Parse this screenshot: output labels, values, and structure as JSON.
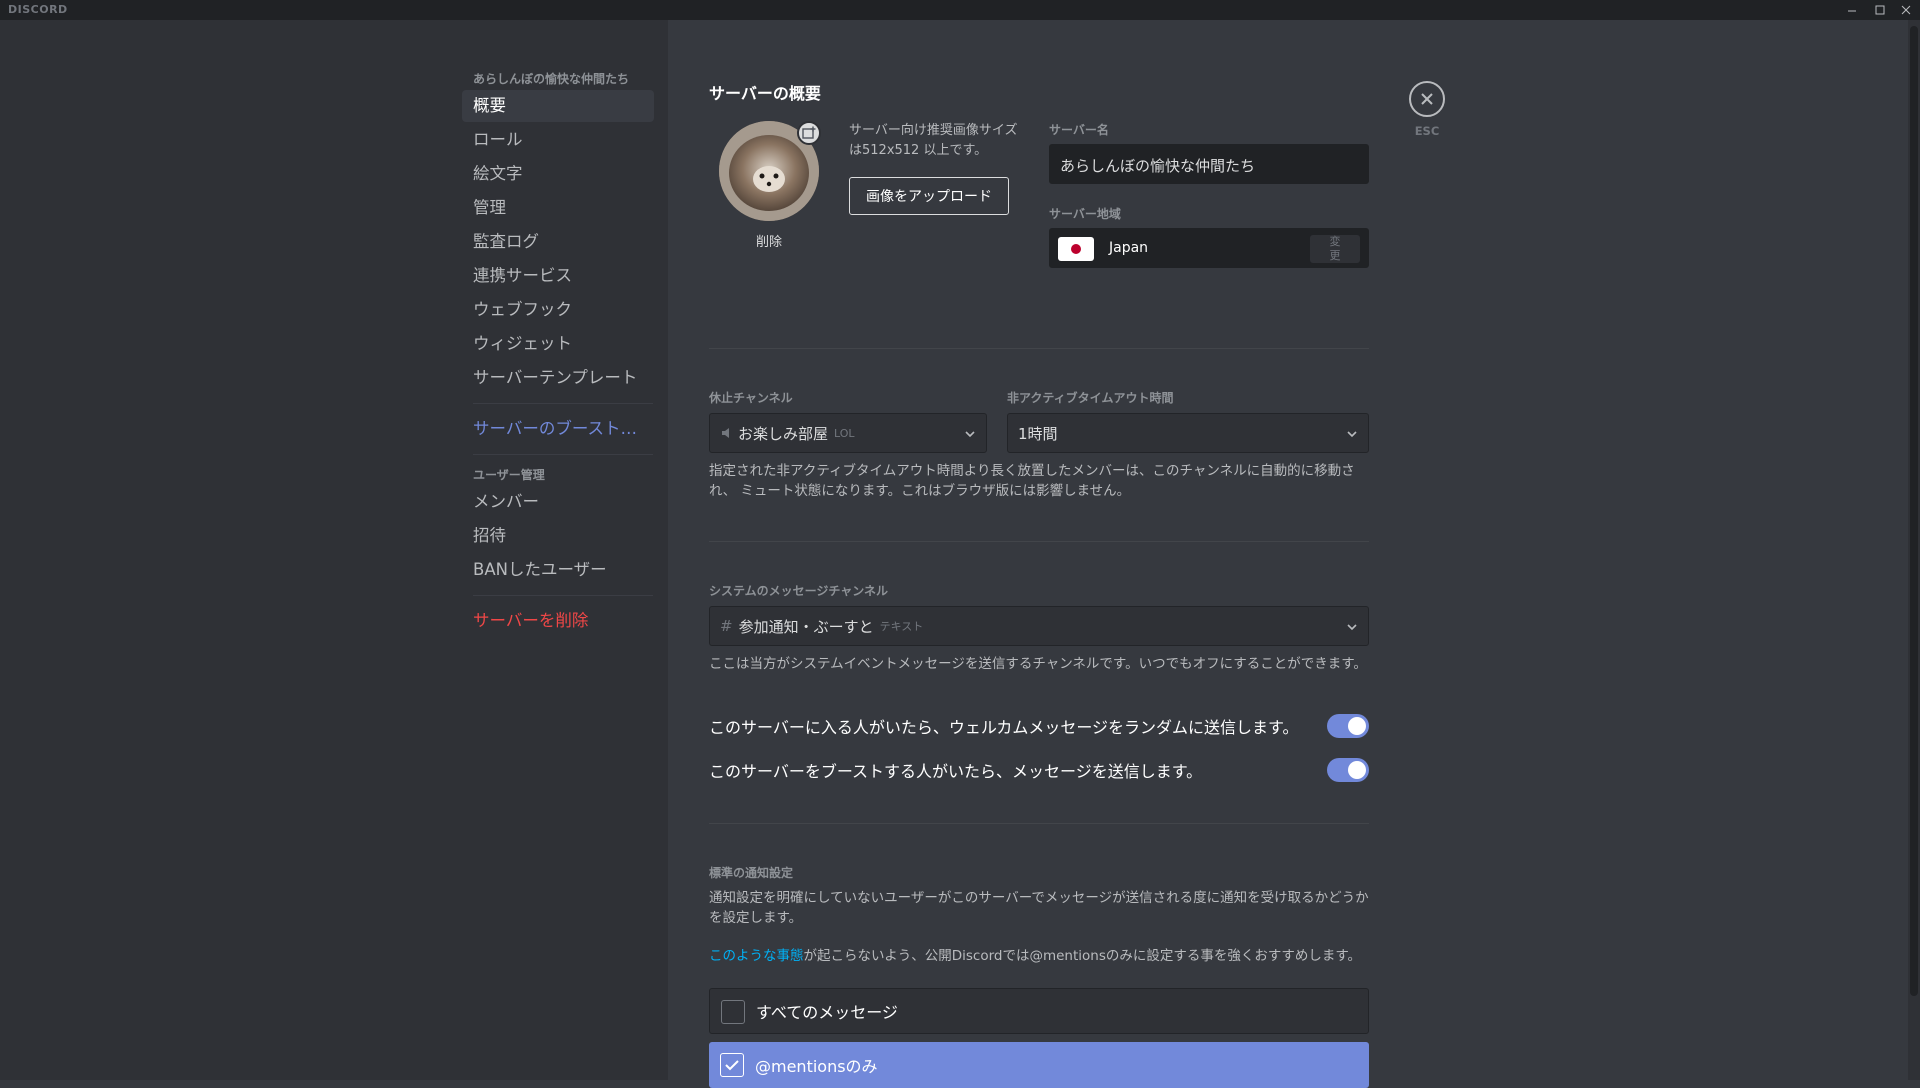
{
  "app": {
    "brand": "DISCORD"
  },
  "sidebar": {
    "server_header": "あらしんぼの愉快な仲間たち",
    "items": [
      {
        "label": "概要"
      },
      {
        "label": "ロール"
      },
      {
        "label": "絵文字"
      },
      {
        "label": "管理"
      },
      {
        "label": "監査ログ"
      },
      {
        "label": "連携サービス"
      },
      {
        "label": "ウェブフック"
      },
      {
        "label": "ウィジェット"
      },
      {
        "label": "サーバーテンプレート"
      }
    ],
    "boost_label": "サーバーのブースト状...",
    "user_header": "ユーザー管理",
    "user_items": [
      {
        "label": "メンバー"
      },
      {
        "label": "招待"
      },
      {
        "label": "BANしたユーザー"
      }
    ],
    "delete_label": "サーバーを削除"
  },
  "overview": {
    "title": "サーバーの概要",
    "image_hint": "サーバー向け推奨画像サイズは512x512 以上です。",
    "upload_button": "画像をアップロード",
    "remove_label": "削除",
    "server_name_label": "サーバー名",
    "server_name_value": "あらしんぼの愉快な仲間たち",
    "region_label": "サーバー地域",
    "region_value": "Japan",
    "region_change": "変更"
  },
  "afk": {
    "channel_label": "休止チャンネル",
    "channel_value": "お楽しみ部屋",
    "channel_tag": "LOL",
    "timeout_label": "非アクティブタイムアウト時間",
    "timeout_value": "1時間",
    "description": "指定された非アクティブタイムアウト時間より長く放置したメンバーは、このチャンネルに自動的に移動され、 ミュート状態になります。これはブラウザ版には影響しません。"
  },
  "system": {
    "label": "システムのメッセージチャンネル",
    "channel_value": "参加通知・ぶーすと",
    "channel_tag": "テキスト",
    "description": "ここは当方がシステムイベントメッセージを送信するチャンネルです。いつでもオフにすることができます。",
    "welcome_toggle_label": "このサーバーに入る人がいたら、ウェルカムメッセージをランダムに送信します。",
    "welcome_toggle_on": true,
    "boost_toggle_label": "このサーバーをブーストする人がいたら、メッセージを送信します。",
    "boost_toggle_on": true
  },
  "notifications": {
    "label": "標準の通知設定",
    "description": "通知設定を明確にしていないユーザーがこのサーバーでメッセージが送信される度に通知を受け取るかどうかを設定します。",
    "tip_link": "このような事態",
    "tip_rest": "が起こらないよう、公開Discordでは@mentionsのみに設定する事を強くおすすめします。",
    "options": [
      {
        "label": "すべてのメッセージ",
        "selected": false
      },
      {
        "label": "@mentionsのみ",
        "selected": true
      }
    ]
  },
  "close": {
    "esc_label": "ESC"
  },
  "colors": {
    "accent": "#7289da",
    "danger": "#f04747",
    "link": "#00b0f4",
    "background": "#36393f",
    "sidebar": "#2f3136"
  }
}
